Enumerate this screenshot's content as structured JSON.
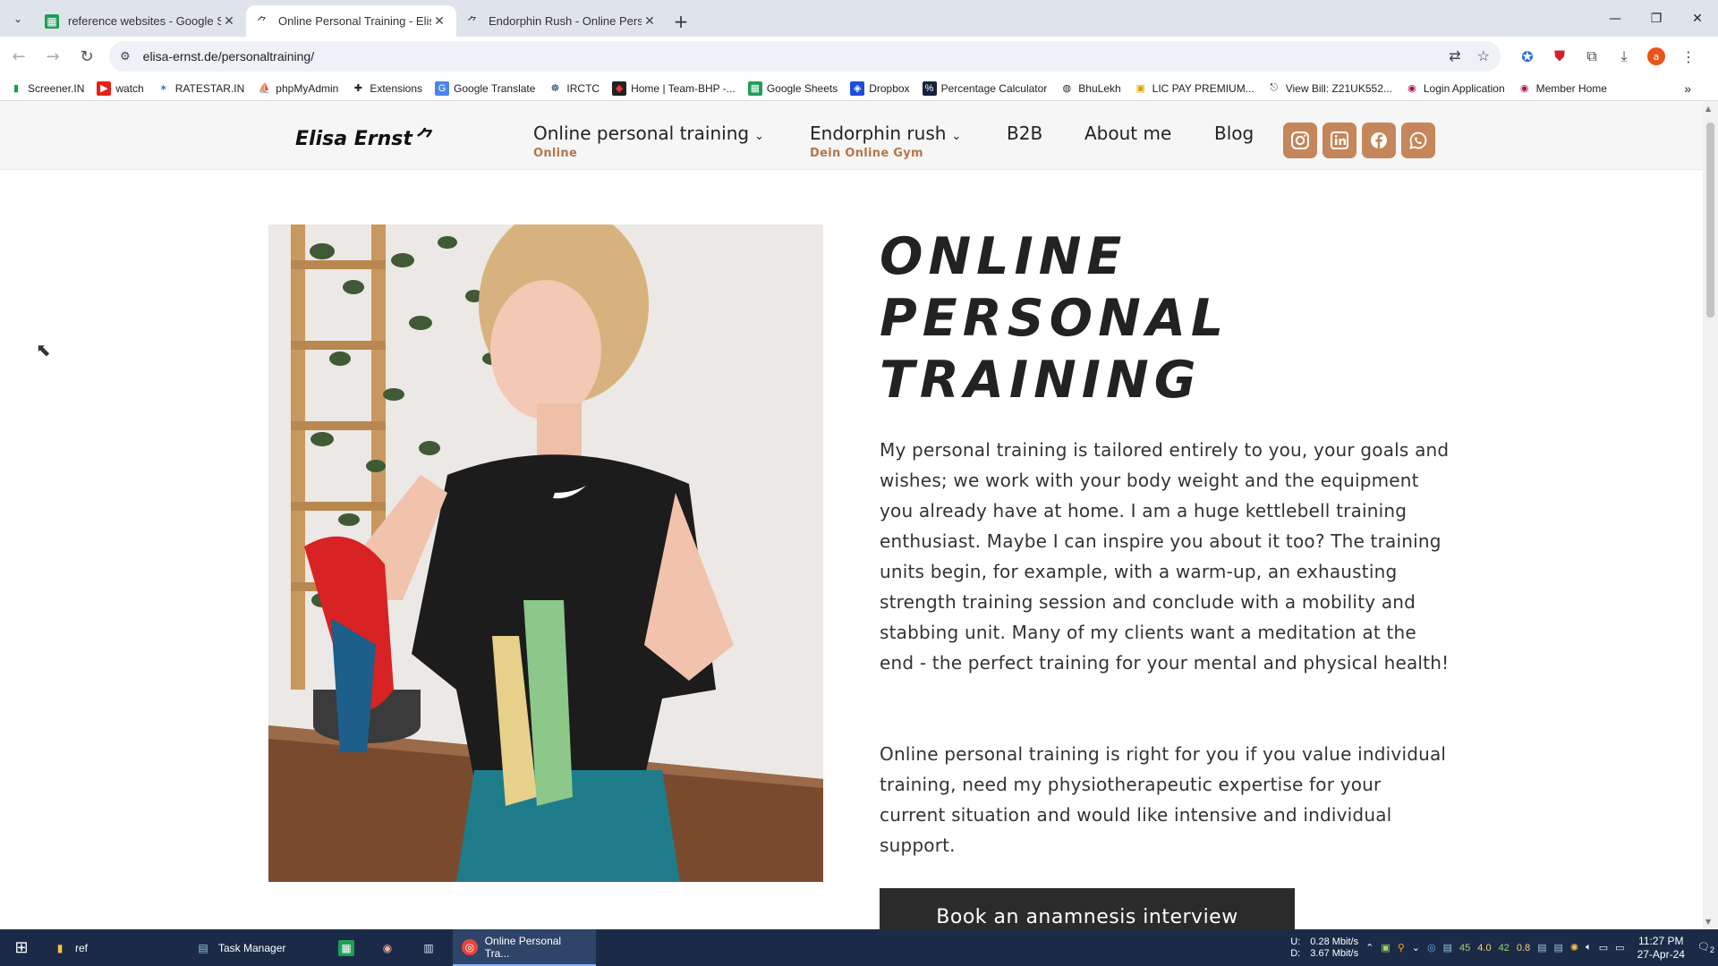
{
  "browser": {
    "tabs": [
      {
        "title": "reference websites - Google Sh",
        "active": false
      },
      {
        "title": "Online Personal Training - Elisa",
        "active": true
      },
      {
        "title": "Endorphin Rush - Online Perso",
        "active": false
      }
    ],
    "url": "elisa-ernst.de/personaltraining/",
    "bookmarks": [
      "Screener.IN",
      "watch",
      "RATESTAR.IN",
      "phpMyAdmin",
      "Extensions",
      "Google Translate",
      "IRCTC",
      "Home | Team-BHP -...",
      "Google Sheets",
      "Dropbox",
      "Percentage Calculator",
      "BhuLekh",
      "LIC PAY PREMIUM...",
      "View Bill: Z21UK552...",
      "Login Application",
      "Member Home"
    ],
    "profile_initial": "a"
  },
  "site": {
    "logo": "Elisa Ernst",
    "nav": {
      "item1": {
        "label": "Online personal training",
        "sub": "Online"
      },
      "item2": {
        "label": "Endorphin rush",
        "sub": "Dein Online Gym"
      },
      "item3": {
        "label": "B2B"
      },
      "item4": {
        "label": "About me"
      },
      "item5": {
        "label": "Blog"
      }
    },
    "accent_color": "#c4865a",
    "heading_lines": [
      "ONLINE",
      "PERSONAL",
      "TRAINING"
    ],
    "paragraph1": "My personal training is tailored entirely to you, your goals and wishes; we work with your body weight and the equipment you already have at home. I am a huge kettlebell training enthusiast. Maybe I can inspire you about it too? The training units begin, for example, with a warm-up, an exhausting strength training session and conclude with a mobility and stabbing unit. Many of my clients want a meditation at the end - the perfect training for your mental and physical health!",
    "paragraph2": "Online personal training is right for you if you value individual training, need my physiotherapeutic expertise for your current situation and would like intensive and individual support.",
    "cta": "Book an anamnesis interview"
  },
  "taskbar": {
    "apps": [
      "ref",
      "Task Manager",
      "Online Personal Tra..."
    ],
    "net_up": "0.28 Mbit/s",
    "net_down": "3.67 Mbit/s",
    "net_up_label": "U:",
    "net_down_label": "D:",
    "tray_nums": [
      "45",
      "4.0",
      "42",
      "0.8"
    ],
    "time": "11:27 PM",
    "date": "27-Apr-24",
    "notif_count": "2"
  }
}
